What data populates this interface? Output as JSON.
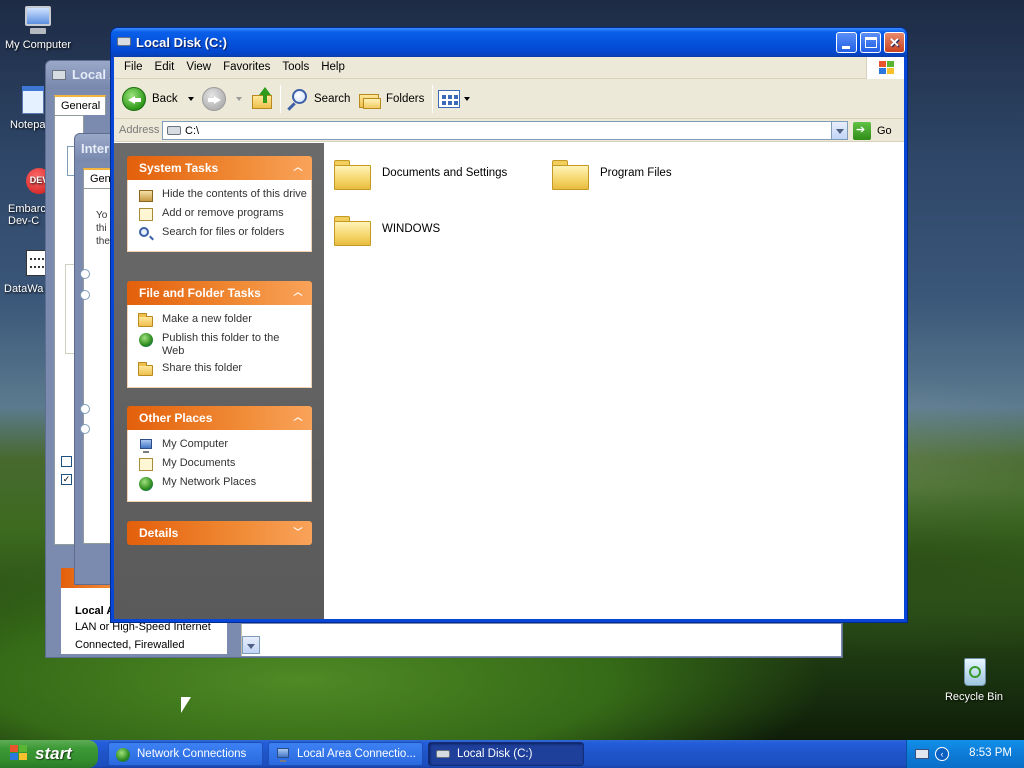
{
  "desktop": {
    "icons": [
      {
        "label": "My Computer"
      },
      {
        "label": "Notepa"
      },
      {
        "label": "Embarca Dev-C"
      },
      {
        "label": "DataWa"
      },
      {
        "label": "Recycle Bin"
      }
    ]
  },
  "background_windows": {
    "local_area": {
      "title": "Local A",
      "tab": "General",
      "status_title": "Local A",
      "status_line1": "LAN or High-Speed Internet",
      "status_line2": "Connected, Firewalled"
    },
    "internet": {
      "title": "Inter",
      "tab": "Gene"
    }
  },
  "window": {
    "title": "Local Disk (C:)",
    "menu": [
      "File",
      "Edit",
      "View",
      "Favorites",
      "Tools",
      "Help"
    ],
    "toolbar": {
      "back": "Back",
      "search": "Search",
      "folders": "Folders"
    },
    "address": {
      "label": "Address",
      "value": "C:\\",
      "go": "Go"
    },
    "task_pane": {
      "system_tasks": {
        "title": "System Tasks",
        "items": [
          "Hide the contents of this drive",
          "Add or remove programs",
          "Search for files or folders"
        ]
      },
      "file_folder_tasks": {
        "title": "File and Folder Tasks",
        "items": [
          "Make a new folder",
          "Publish this folder to the Web",
          "Share this folder"
        ]
      },
      "other_places": {
        "title": "Other Places",
        "items": [
          "My Computer",
          "My Documents",
          "My Network Places"
        ]
      },
      "details": {
        "title": "Details"
      }
    },
    "folders": [
      {
        "name": "Documents and Settings"
      },
      {
        "name": "Program Files"
      },
      {
        "name": "WINDOWS"
      }
    ]
  },
  "taskbar": {
    "start": "start",
    "tasks": [
      {
        "label": "Network Connections",
        "active": false
      },
      {
        "label": "Local Area Connectio...",
        "active": false
      },
      {
        "label": "Local Disk (C:)",
        "active": true
      }
    ],
    "clock": "8:53 PM"
  },
  "colors": {
    "title_blue": "#0552dc",
    "taskpane_header": "#e35f0b",
    "start_green": "#3c9a36",
    "close_red": "#c9431f"
  }
}
